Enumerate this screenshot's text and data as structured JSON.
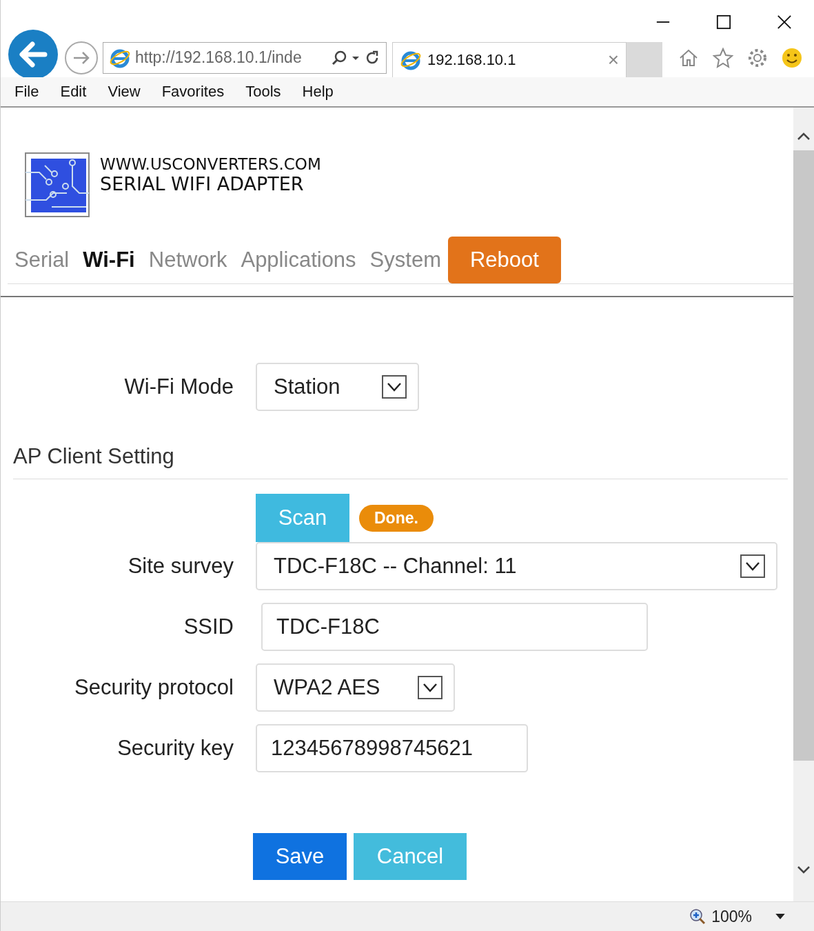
{
  "browser": {
    "address": "http://192.168.10.1/inde",
    "tab_title": "192.168.10.1",
    "tab_close": "×",
    "menu": [
      "File",
      "Edit",
      "View",
      "Favorites",
      "Tools",
      "Help"
    ]
  },
  "header": {
    "line1": "WWW.USCONVERTERS.COM",
    "line2": "SERIAL WIFI ADAPTER"
  },
  "nav": [
    {
      "label": "Serial",
      "kind": "tab",
      "selected": false
    },
    {
      "label": "Wi-Fi",
      "kind": "tab",
      "selected": true
    },
    {
      "label": "Network",
      "kind": "tab",
      "selected": false
    },
    {
      "label": "Applications",
      "kind": "tab",
      "selected": false
    },
    {
      "label": "System",
      "kind": "tab",
      "selected": false
    },
    {
      "label": "Reboot",
      "kind": "button"
    }
  ],
  "wifi_mode": {
    "label": "Wi-Fi Mode",
    "value": "Station"
  },
  "section_title": "AP Client Setting",
  "scan": {
    "label": "Scan",
    "status": "Done."
  },
  "fields": [
    {
      "label": "Site survey",
      "kind": "select",
      "value": "TDC-F18C -- Channel: 11"
    },
    {
      "label": "SSID",
      "kind": "input",
      "value": "TDC-F18C"
    },
    {
      "label": "Security protocol",
      "kind": "select",
      "value": "WPA2 AES"
    },
    {
      "label": "Security key",
      "kind": "input",
      "value": "12345678998745621"
    }
  ],
  "buttons": [
    {
      "label": "Save",
      "kind": "primary"
    },
    {
      "label": "Cancel",
      "kind": "secondary"
    }
  ],
  "status_bar": {
    "zoom": "100%"
  }
}
